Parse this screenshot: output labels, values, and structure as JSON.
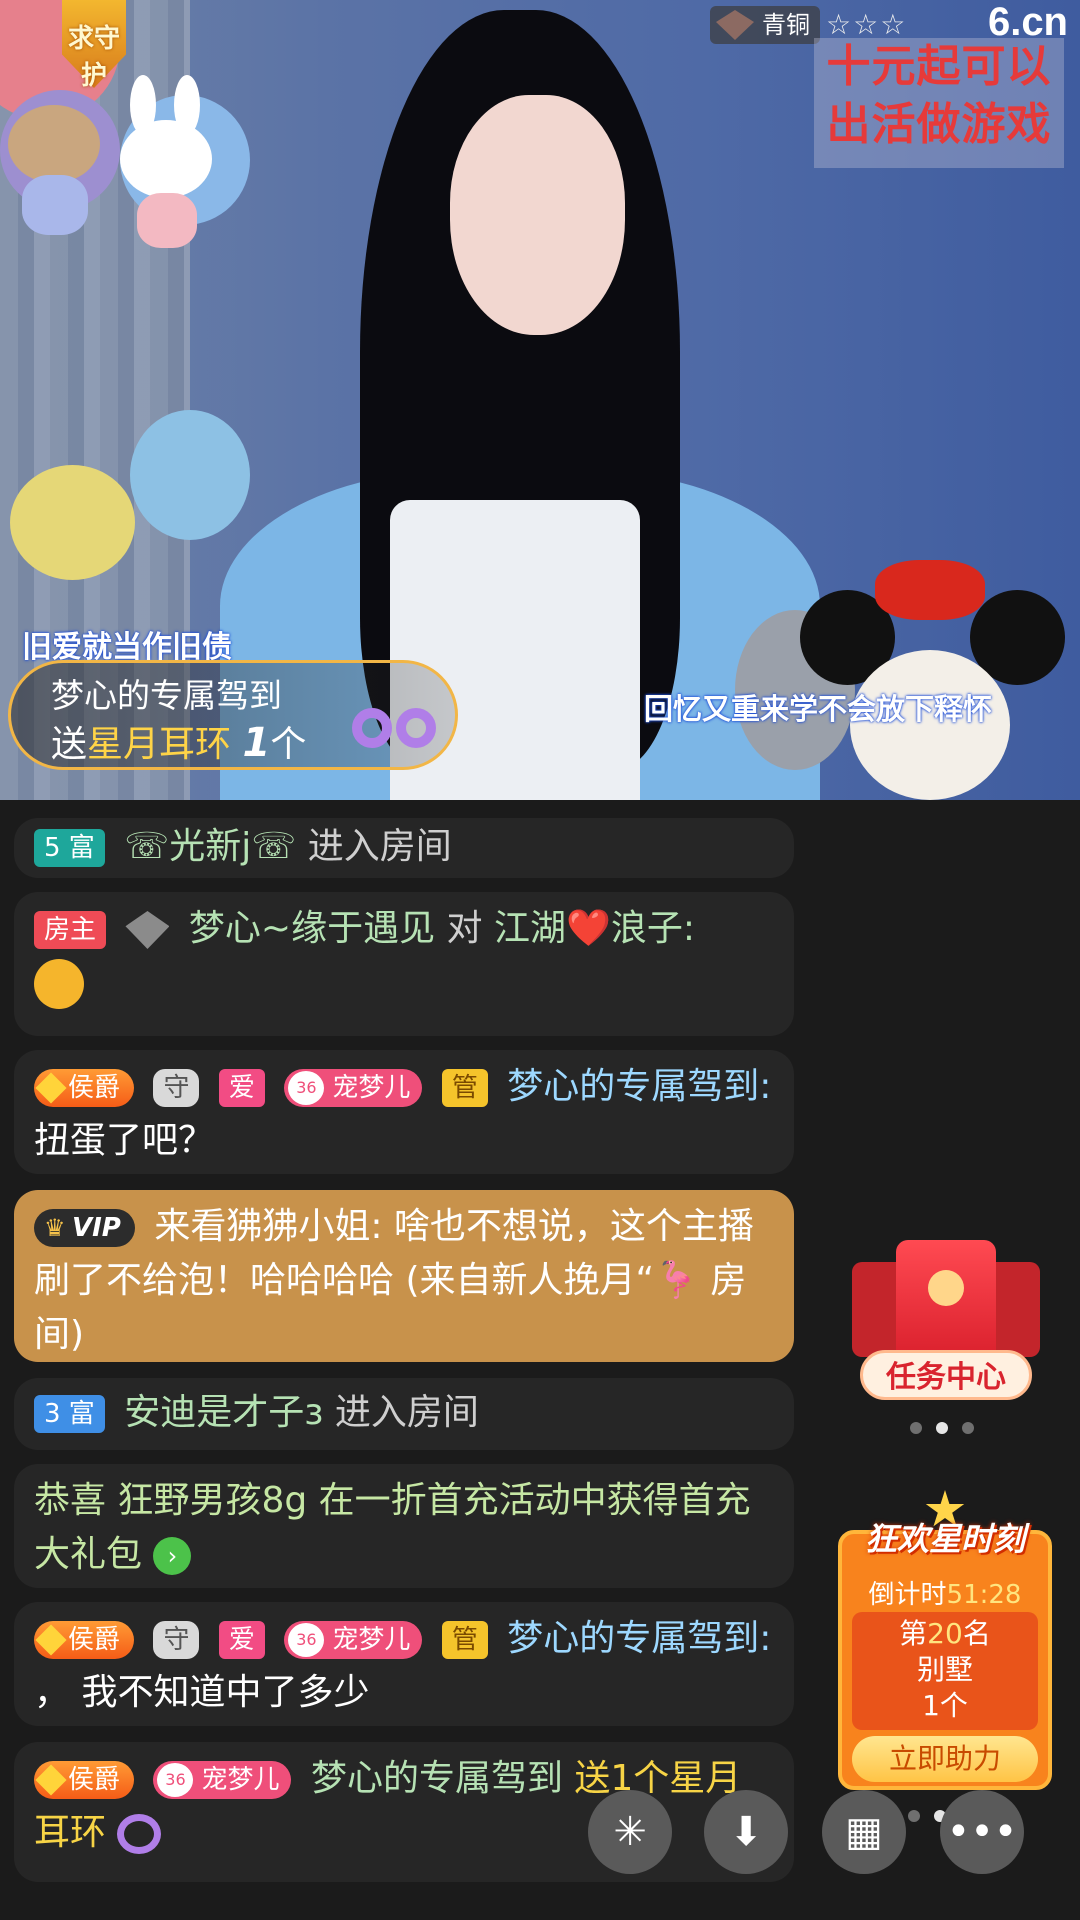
{
  "stream": {
    "logo": "6.cn",
    "level_label": "青铜",
    "level_stars": "☆☆☆",
    "guard_badge": "求守护",
    "promo_line1": "十元起可以",
    "promo_line2": "出活做游戏",
    "song_left": "旧爱就当作旧债",
    "song_right": "回忆又重来学不会放下释怀"
  },
  "gift_banner": {
    "sender": "梦心的专属驾到",
    "send_word": "送",
    "gift_name": "星月耳环",
    "count": "1",
    "unit": "个"
  },
  "chat": [
    {
      "badge": "5 富",
      "name": "☏光新j☏",
      "text": "进入房间"
    },
    {
      "host_badge": "房主",
      "name": "梦心~缘于遇见",
      "connector": "对",
      "target": "江湖❤️浪子:"
    },
    {
      "duke": "侯爵",
      "guard": "守",
      "love": "爱",
      "fan_level": "36",
      "fan": "宠梦儿",
      "admin": "管",
      "name": "梦心的专属驾到:",
      "text": "扭蛋了吧？"
    },
    {
      "vip": "VIP",
      "name": "来看狒狒小姐:",
      "text": "啥也不想说，这个主播刷了不给泡！哈哈哈哈 (来自新人挽月“🦩 房间)"
    },
    {
      "badge": "3 富",
      "name": "安迪是才子ɜ",
      "text": "进入房间"
    },
    {
      "text": "恭喜 狂野男孩8g 在一折首充活动中获得首充大礼包"
    },
    {
      "duke": "侯爵",
      "guard": "守",
      "love": "爱",
      "fan_level": "36",
      "fan": "宠梦儿",
      "admin": "管",
      "name": "梦心的专属驾到:",
      "text": "， 我不知道中了多少"
    },
    {
      "duke": "侯爵",
      "fan_level": "36",
      "fan": "宠梦儿",
      "name": "梦心的专属驾到",
      "text": "送1个星月耳环"
    }
  ],
  "task_center": {
    "label": "任务中心"
  },
  "carnival": {
    "title": "狂欢星时刻",
    "countdown_label": "倒计时",
    "countdown": "51:28",
    "rank_prefix": "第",
    "rank": "20",
    "rank_suffix": "名",
    "prize": "别墅",
    "prize_count": "1个",
    "cta": "立即助力"
  },
  "icons": {
    "share": "sparkle-icon",
    "download": "download-icon",
    "apps": "grid-icon",
    "more": "more-icon"
  },
  "colors": {
    "vip_bubble": "#c8924b",
    "name_green": "#b6e2b4",
    "name_blue": "#9dd8ff",
    "gold_text": "#f7d446"
  }
}
